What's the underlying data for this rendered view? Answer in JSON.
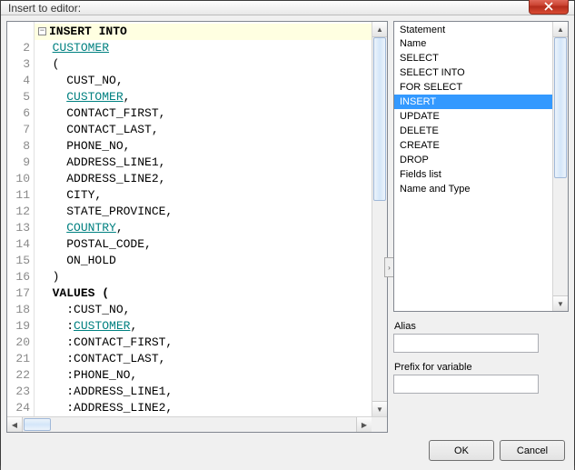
{
  "window": {
    "title": "Insert to editor:"
  },
  "code": {
    "lines": [
      {
        "n": "",
        "type": "kw_fold",
        "text": "INSERT INTO"
      },
      {
        "n": "2",
        "type": "link",
        "indent": "  ",
        "text": "CUSTOMER"
      },
      {
        "n": "3",
        "type": "plain",
        "indent": "  ",
        "text": "("
      },
      {
        "n": "4",
        "type": "col",
        "indent": "    ",
        "text": "CUST_NO,"
      },
      {
        "n": "5",
        "type": "link_comma",
        "indent": "    ",
        "text": "CUSTOMER"
      },
      {
        "n": "6",
        "type": "col",
        "indent": "    ",
        "text": "CONTACT_FIRST,"
      },
      {
        "n": "7",
        "type": "col",
        "indent": "    ",
        "text": "CONTACT_LAST,"
      },
      {
        "n": "8",
        "type": "col",
        "indent": "    ",
        "text": "PHONE_NO,"
      },
      {
        "n": "9",
        "type": "col",
        "indent": "    ",
        "text": "ADDRESS_LINE1,"
      },
      {
        "n": "10",
        "type": "col",
        "indent": "    ",
        "text": "ADDRESS_LINE2,"
      },
      {
        "n": "11",
        "type": "col",
        "indent": "    ",
        "text": "CITY,"
      },
      {
        "n": "12",
        "type": "col",
        "indent": "    ",
        "text": "STATE_PROVINCE,"
      },
      {
        "n": "13",
        "type": "link_comma",
        "indent": "    ",
        "text": "COUNTRY"
      },
      {
        "n": "14",
        "type": "col",
        "indent": "    ",
        "text": "POSTAL_CODE,"
      },
      {
        "n": "15",
        "type": "col",
        "indent": "    ",
        "text": "ON_HOLD"
      },
      {
        "n": "16",
        "type": "plain",
        "indent": "  ",
        "text": ")"
      },
      {
        "n": "17",
        "type": "kw_values",
        "indent": "  ",
        "text": "VALUES ("
      },
      {
        "n": "18",
        "type": "col",
        "indent": "    ",
        "text": ":CUST_NO,"
      },
      {
        "n": "19",
        "type": "link_comma",
        "indent": "    ",
        "text": ":CUSTOMER"
      },
      {
        "n": "20",
        "type": "col",
        "indent": "    ",
        "text": ":CONTACT_FIRST,"
      },
      {
        "n": "21",
        "type": "col",
        "indent": "    ",
        "text": ":CONTACT_LAST,"
      },
      {
        "n": "22",
        "type": "col",
        "indent": "    ",
        "text": ":PHONE_NO,"
      },
      {
        "n": "23",
        "type": "col",
        "indent": "    ",
        "text": ":ADDRESS_LINE1,"
      },
      {
        "n": "24",
        "type": "col",
        "indent": "    ",
        "text": ":ADDRESS_LINE2,"
      }
    ]
  },
  "statements": {
    "header": "Statement",
    "items": [
      {
        "label": "Name",
        "selected": false
      },
      {
        "label": "SELECT",
        "selected": false
      },
      {
        "label": "SELECT INTO",
        "selected": false
      },
      {
        "label": "FOR SELECT",
        "selected": false
      },
      {
        "label": "INSERT",
        "selected": true
      },
      {
        "label": "UPDATE",
        "selected": false
      },
      {
        "label": "DELETE",
        "selected": false
      },
      {
        "label": "CREATE",
        "selected": false
      },
      {
        "label": "DROP",
        "selected": false
      },
      {
        "label": "Fields list",
        "selected": false
      },
      {
        "label": "Name and Type",
        "selected": false
      }
    ]
  },
  "fields": {
    "alias": {
      "label": "Alias",
      "value": ""
    },
    "prefix": {
      "label": "Prefix for variable",
      "value": ""
    }
  },
  "buttons": {
    "ok": "OK",
    "cancel": "Cancel"
  },
  "glyphs": {
    "fold_minus": "−",
    "expander": "›"
  }
}
